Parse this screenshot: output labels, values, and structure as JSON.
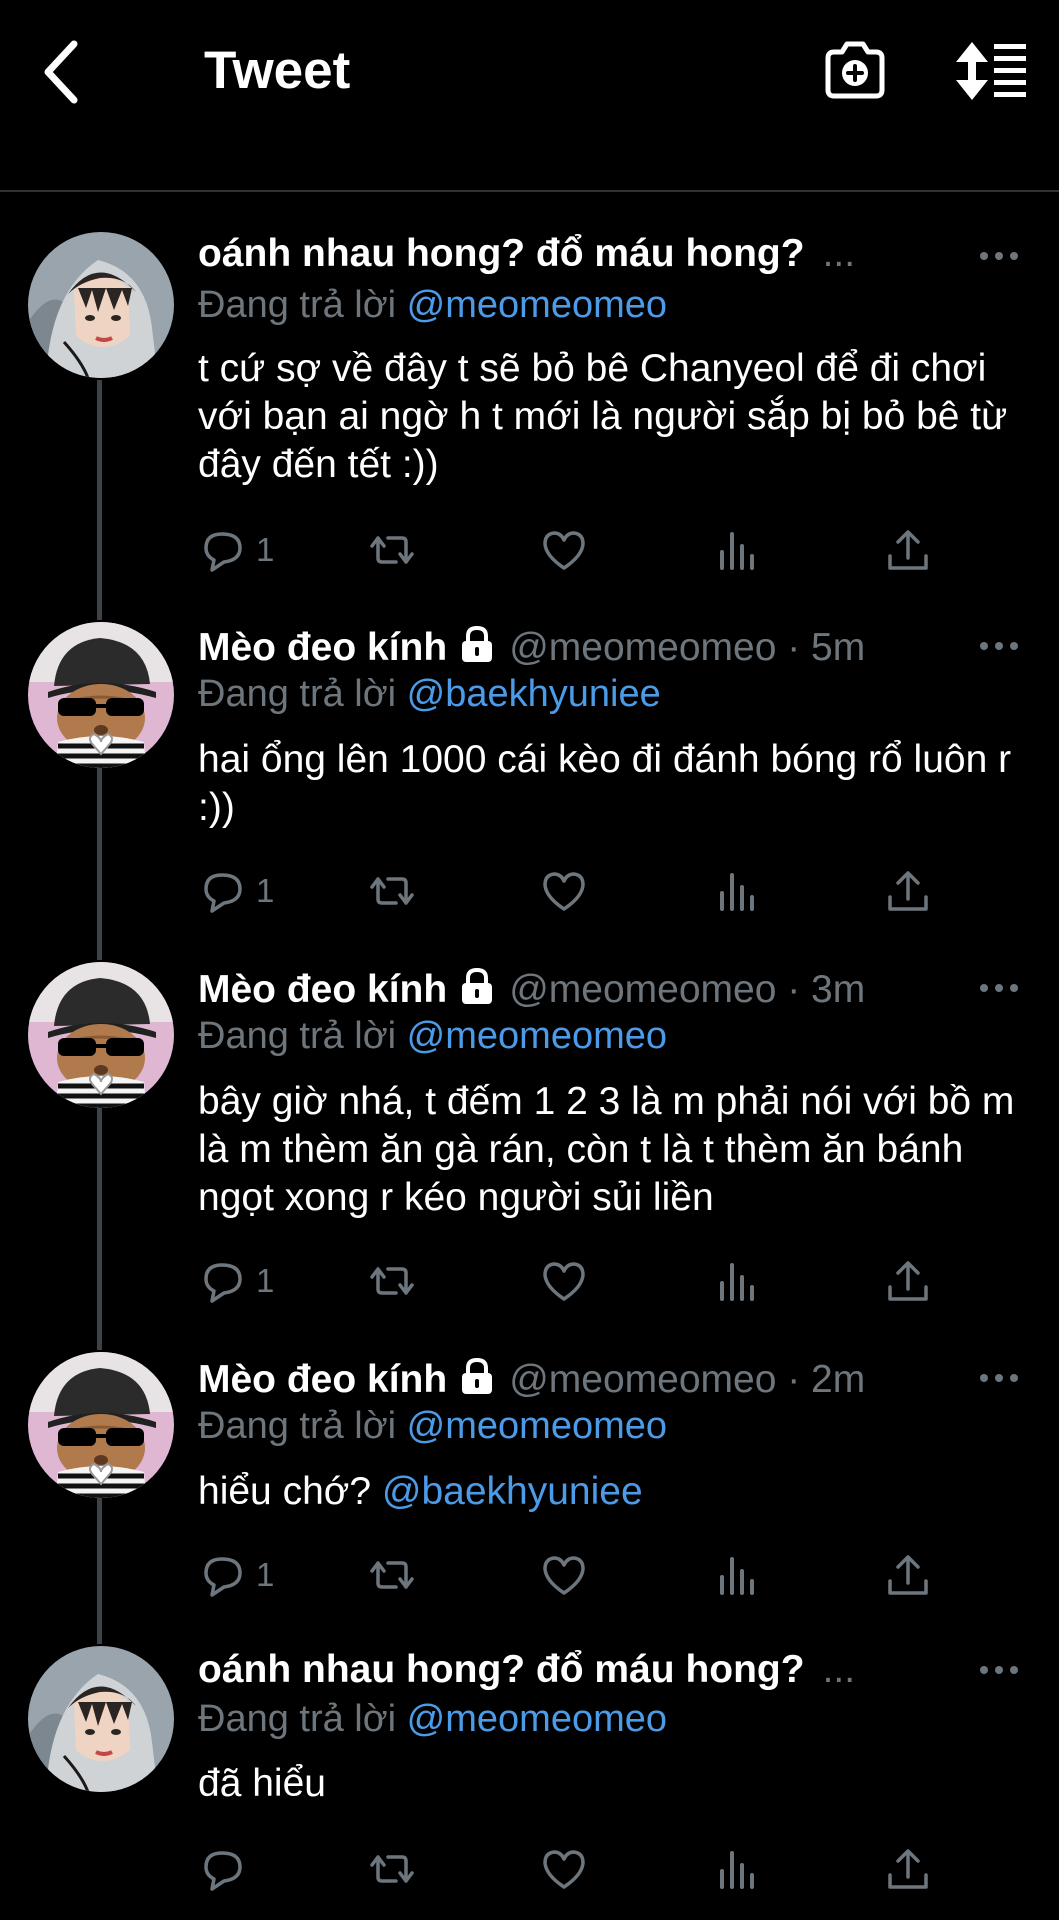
{
  "header": {
    "title": "Tweet"
  },
  "tweets": [
    {
      "name": "oánh nhau hong? đổ máu hong?",
      "handle_meta": "...",
      "reply_prefix": "Đang trả lời",
      "reply_to": "@meomeomeo",
      "text": "t cứ sợ về đây t sẽ bỏ bê Chanyeol để đi chơi với bạn ai ngờ h t mới là người sắp bị bỏ bê từ đây đến tết :))",
      "reply_count": "1",
      "avatar": "boy-hoodie",
      "locked": false
    },
    {
      "name": "Mèo đeo kính",
      "handle_meta": "@meomeomeo · 5m",
      "reply_prefix": "Đang trả lời",
      "reply_to": "@baekhyuniee",
      "text": "hai ổng lên 1000 cái kèo đi đánh bóng rổ luôn r :))",
      "reply_count": "1",
      "avatar": "cat-sunglasses",
      "locked": true
    },
    {
      "name": "Mèo đeo kính",
      "handle_meta": "@meomeomeo · 3m",
      "reply_prefix": "Đang trả lời",
      "reply_to": "@meomeomeo",
      "text": "bây giờ nhá, t đếm 1 2 3 là m phải nói với bồ m là m thèm ăn gà rán, còn t là t thèm ăn bánh ngọt xong r kéo người sủi liền",
      "reply_count": "1",
      "avatar": "cat-sunglasses",
      "locked": true
    },
    {
      "name": "Mèo đeo kính",
      "handle_meta": "@meomeomeo · 2m",
      "reply_prefix": "Đang trả lời",
      "reply_to": "@meomeomeo",
      "text_prefix": "hiểu chớ? ",
      "text_mention": "@baekhyuniee",
      "reply_count": "1",
      "avatar": "cat-sunglasses",
      "locked": true
    },
    {
      "name": "oánh nhau hong? đổ máu hong?",
      "handle_meta": "...",
      "reply_prefix": "Đang trả lời",
      "reply_to": "@meomeomeo",
      "text": "đã hiểu",
      "reply_count": "",
      "avatar": "boy-hoodie",
      "locked": false
    }
  ],
  "colors": {
    "background": "#000000",
    "muted": "#6e767d",
    "link": "#4b9be8",
    "divider": "#2f3336"
  },
  "icons": [
    "back-arrow-icon",
    "camera-plus-icon",
    "sort-icon",
    "more-icon",
    "reply-icon",
    "retweet-icon",
    "like-icon",
    "analytics-icon",
    "share-icon",
    "lock-icon"
  ]
}
